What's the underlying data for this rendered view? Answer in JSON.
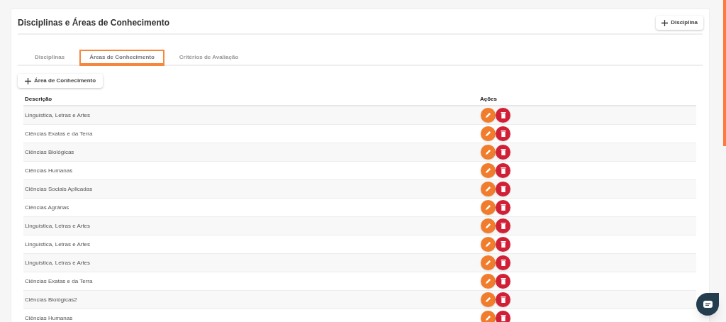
{
  "page": {
    "title": "Disciplinas e Áreas de Conhecimento",
    "add_button": "Disciplina"
  },
  "tabs": [
    {
      "label": "Disciplinas",
      "selected": false
    },
    {
      "label": "Áreas de Conhecimento",
      "selected": true
    },
    {
      "label": "Critérios de Avaliação",
      "selected": false
    }
  ],
  "add_area_button": "Área de Conhecimento",
  "table": {
    "columns": [
      "Descrição",
      "Ações"
    ],
    "rows": [
      "Linguística, Letras e Artes",
      "Ciências Exatas e da Terra",
      "Ciências Biológicas",
      "Ciências Humanas",
      "Ciências Sociais Aplicadas",
      "Ciências Agrárias",
      "Linguística, Letras e Artes",
      "Linguística, Letras e Artes",
      "Linguística, Letras e Artes",
      "Ciências Exatas e da Terra",
      "Ciências Biológicas2",
      "Ciências Humanas"
    ]
  }
}
